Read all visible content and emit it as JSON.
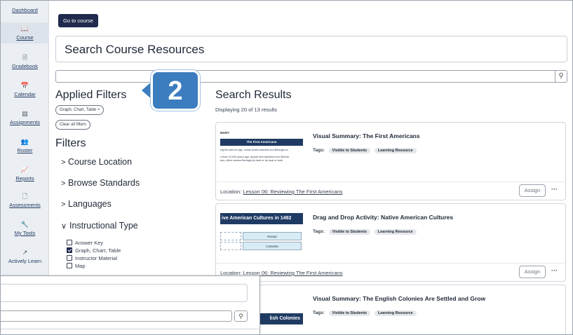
{
  "sidebar": {
    "items": [
      {
        "label": "Dashboard",
        "icon": "dashboard-icon",
        "glyph": ""
      },
      {
        "label": "Course",
        "icon": "book-icon",
        "glyph": "📖"
      },
      {
        "label": "Gradebook",
        "icon": "gradebook-icon",
        "glyph": "🗎"
      },
      {
        "label": "Calendar",
        "icon": "calendar-icon",
        "glyph": "📅"
      },
      {
        "label": "Assignments",
        "icon": "assignments-icon",
        "glyph": "▤"
      },
      {
        "label": "Roster",
        "icon": "roster-icon",
        "glyph": "👥"
      },
      {
        "label": "Reports",
        "icon": "reports-icon",
        "glyph": "📈"
      },
      {
        "label": "Assessments",
        "icon": "assessments-icon",
        "glyph": "🗋"
      },
      {
        "label": "My Tools",
        "icon": "tools-icon",
        "glyph": "🔧"
      },
      {
        "label": "Actively Learn",
        "icon": "external-link-icon",
        "glyph": "↗"
      }
    ]
  },
  "header": {
    "go_to_course": "Go to course",
    "page_title": "Search Course Resources",
    "search_placeholder": "",
    "search_icon": "⚲"
  },
  "callout": {
    "number": "2"
  },
  "filters": {
    "applied_title": "Applied Filters",
    "applied_chip": "Graph, Chart, Table ×",
    "clear_all": "Clear all filters",
    "title": "Filters",
    "groups": [
      {
        "label": "Course Location",
        "chevron": ">"
      },
      {
        "label": "Browse Standards",
        "chevron": ">"
      },
      {
        "label": "Languages",
        "chevron": ">"
      },
      {
        "label": "Instructional Type",
        "chevron": "∨"
      }
    ],
    "instructional_types": [
      {
        "label": "Answer Key",
        "checked": false
      },
      {
        "label": "Graph, Chart, Table",
        "checked": true
      },
      {
        "label": "Instructor Material",
        "checked": false
      },
      {
        "label": "Map",
        "checked": false
      }
    ]
  },
  "results": {
    "title": "Search Results",
    "count_text": "Displaying 20 of 13 results",
    "tags_label": "Tags:",
    "location_label": "Location:",
    "assign_label": "Assign",
    "more_label": "···",
    "items": [
      {
        "title": "Visual Summary: The First Americans",
        "tags": [
          "Visible to Students",
          "Learning Resource"
        ],
        "location": "Lesson 06: Reviewing The First Americans",
        "thumb": {
          "heading": "MARY",
          "bar": "The First Americans",
          "lines": [
            "ing the last ice age, ocean levels lowered and Beringia en",
            "e than 10,000 years ago, people first traveled from Siberia",
            "ans, either across Beringia by land or by boat or both."
          ]
        }
      },
      {
        "title": "Drag and Drop Activity: Native American Cultures",
        "tags": [
          "Visible to Students",
          "Learning Resource"
        ],
        "location": "Lesson 06: Reviewing The First Americans",
        "thumb": {
          "bar": "ive American Cultures in 1492",
          "cells": [
            "Navajo",
            "Catawba"
          ]
        }
      },
      {
        "title": "Visual Summary: The English Colonies Are Settled and Grow",
        "tags": [
          "Visible to Students",
          "Learning Resource"
        ],
        "thumb": {
          "bar": "lish Colonies"
        }
      }
    ]
  },
  "overlay": {
    "search_icon": "⚲"
  },
  "colors": {
    "navy": "#1f2a4d",
    "callout_blue": "#3b7dbf",
    "sidebar_bg": "#ebeef2"
  }
}
